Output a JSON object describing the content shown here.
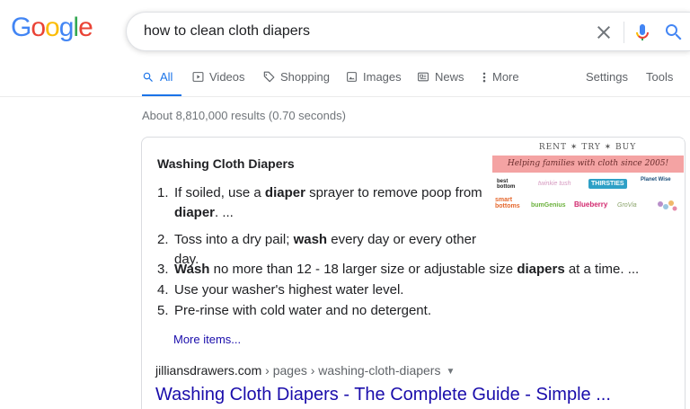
{
  "logo": {
    "letters": [
      "G",
      "o",
      "o",
      "g",
      "l",
      "e"
    ],
    "colors": [
      "#4285f4",
      "#ea4335",
      "#fbbc05",
      "#4285f4",
      "#34a853",
      "#ea4335"
    ]
  },
  "search": {
    "query": "how to clean cloth diapers",
    "icons": [
      "clear-icon",
      "mic-icon",
      "search-icon"
    ]
  },
  "tabs": {
    "items": [
      {
        "label": "All",
        "icon": "search-icon",
        "active": true
      },
      {
        "label": "Videos",
        "icon": "play-icon"
      },
      {
        "label": "Shopping",
        "icon": "tag-icon"
      },
      {
        "label": "Images",
        "icon": "image-icon"
      },
      {
        "label": "News",
        "icon": "news-icon"
      },
      {
        "label": "More",
        "icon": "more-vert-icon"
      }
    ],
    "settings": "Settings",
    "tools": "Tools"
  },
  "result_stats": "About 8,810,000 results (0.70 seconds)",
  "featured_snippet": {
    "title": "Washing Cloth Diapers",
    "image": {
      "header": "RENT ✶ TRY ✶ BUY",
      "banner": "Helping families with cloth since 2005!",
      "logos": [
        "best bottom",
        "twinkie tush",
        "THIRSTIES",
        "Planet Wise",
        "smart bottoms",
        "bumGenius",
        "Blueberry",
        "GroVia"
      ]
    },
    "steps": [
      {
        "num": "1.",
        "parts": [
          {
            "t": "If soiled, use a "
          },
          {
            "t": "diaper",
            "b": true
          },
          {
            "t": " sprayer to remove poop from"
          }
        ],
        "line2": [
          {
            "t": "diaper",
            "b": true
          },
          {
            "t": ". ..."
          }
        ]
      },
      {
        "num": "2.",
        "parts": [
          {
            "t": "Toss into a dry pail; "
          },
          {
            "t": "wash",
            "b": true
          },
          {
            "t": " every day or every other"
          }
        ],
        "line2": [
          {
            "t": "day."
          }
        ]
      },
      {
        "num": "3.",
        "parts": [
          {
            "t": "Wash",
            "b": true
          },
          {
            "t": " no more than 12 - 18 larger size or adjustable size "
          },
          {
            "t": "diapers",
            "b": true
          },
          {
            "t": " at a time. ..."
          }
        ]
      },
      {
        "num": "4.",
        "parts": [
          {
            "t": "Use your washer's highest water level."
          }
        ]
      },
      {
        "num": "5.",
        "parts": [
          {
            "t": "Pre-rinse with cold water and no detergent."
          }
        ]
      }
    ],
    "more_items": "More items..."
  },
  "result": {
    "domain": "jilliansdrawers.com",
    "path": " › pages › washing-cloth-diapers",
    "title": "Washing Cloth Diapers - The Complete Guide - Simple ..."
  }
}
